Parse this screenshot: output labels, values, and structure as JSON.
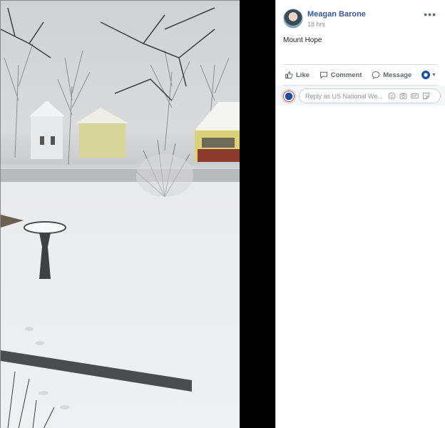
{
  "post": {
    "author": "Meagan Barone",
    "time": "18 hrs",
    "caption": "Mount Hope",
    "more_label": "•••"
  },
  "actions": {
    "like": "Like",
    "comment": "Comment",
    "message": "Message"
  },
  "reply": {
    "placeholder": "Reply as US National We..."
  },
  "colors": {
    "author_link": "#385898",
    "secondary_text": "#90949c",
    "action_text": "#606770",
    "panel_bg": "#ffffff"
  },
  "icons": [
    "like-icon",
    "comment-icon",
    "message-icon",
    "emoji-icon",
    "camera-icon",
    "gif-icon",
    "sticker-icon",
    "more-options-icon"
  ]
}
